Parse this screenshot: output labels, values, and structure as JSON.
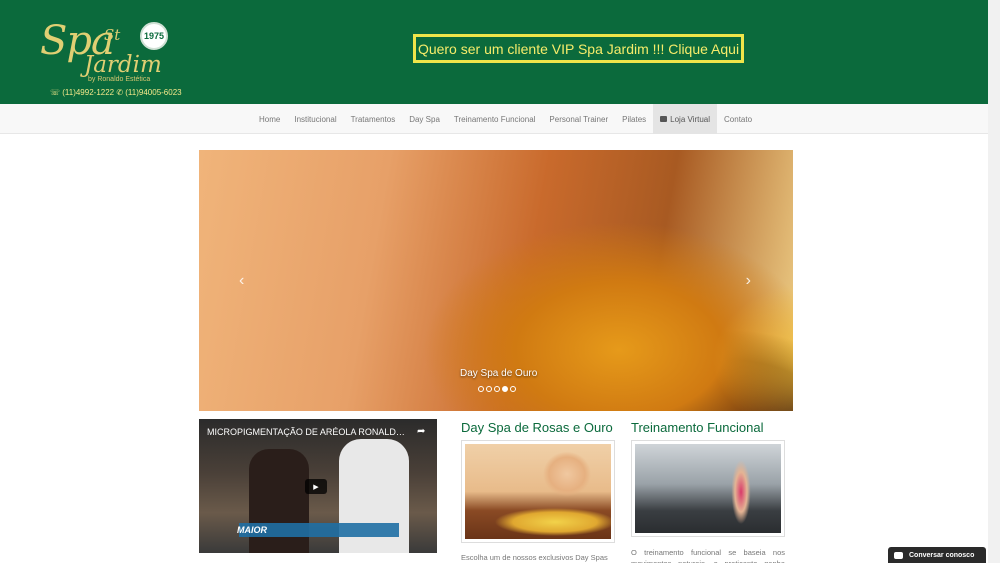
{
  "header": {
    "logo": {
      "spa": "Spa",
      "st": "St",
      "jardim": "Jardim",
      "by": "by Ronaldo Estética",
      "year": "1975"
    },
    "phones": "☏ (11)4992-1222 ✆ (11)94005-6023",
    "vip_button": "Quero ser um cliente VIP Spa Jardim !!! Clique Aqui",
    "bg_color": "#0b6a3c",
    "vip_color": "#efe54a"
  },
  "nav": {
    "items": [
      {
        "label": "Home"
      },
      {
        "label": "Institucional"
      },
      {
        "label": "Tratamentos"
      },
      {
        "label": "Day Spa"
      },
      {
        "label": "Treinamento Funcional"
      },
      {
        "label": "Personal Trainer"
      },
      {
        "label": "Pilates"
      },
      {
        "label": "Loja Virtual",
        "icon": "cart-icon",
        "active": true
      },
      {
        "label": "Contato"
      }
    ]
  },
  "carousel": {
    "caption": "Day Spa de Ouro",
    "prev": "‹",
    "next": "›",
    "slides": 5,
    "active_slide": 4
  },
  "video": {
    "title": "MICROPIGMENTAÇÃO DE ARÉOLA RONALDO C...",
    "share_icon": "share-icon",
    "play_icon": "play-icon",
    "logo_text": "MAIOR"
  },
  "columns": [
    {
      "title": "Day Spa de Rosas e Ouro",
      "text": "Escolha um de nossos exclusivos Day Spas"
    },
    {
      "title": "Treinamento Funcional",
      "text": "O treinamento funcional se baseia nos movimentos naturais, o praticante ganha força"
    }
  ],
  "chat": {
    "label": "Conversar conosco",
    "icon": "chat-icon"
  }
}
